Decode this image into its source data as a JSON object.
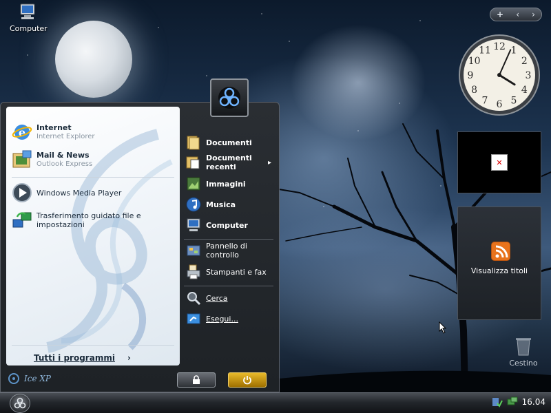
{
  "desktop": {
    "icons": [
      {
        "label": "Computer",
        "icon": "computer-icon"
      },
      {
        "label": "Cestino",
        "icon": "recycle-bin-icon"
      }
    ]
  },
  "start_menu": {
    "pinned": [
      {
        "title": "Internet",
        "subtitle": "Internet Explorer",
        "icon": "internet-explorer-icon"
      },
      {
        "title": "Mail & News",
        "subtitle": "Outlook Express",
        "icon": "outlook-express-icon"
      }
    ],
    "recent": [
      {
        "label": "Windows Media Player",
        "icon": "media-player-icon"
      },
      {
        "label": "Trasferimento guidato file e impostazioni",
        "icon": "file-transfer-icon"
      }
    ],
    "all_programs": "Tutti i programmi",
    "places": [
      {
        "label": "Documenti",
        "icon": "documents-icon"
      },
      {
        "label": "Documenti recenti",
        "icon": "recent-documents-icon"
      },
      {
        "label": "Immagini",
        "icon": "pictures-icon"
      },
      {
        "label": "Musica",
        "icon": "music-icon"
      },
      {
        "label": "Computer",
        "icon": "computer-icon"
      }
    ],
    "settings": [
      {
        "label": "Pannello di controllo",
        "icon": "control-panel-icon"
      },
      {
        "label": "Stampanti e fax",
        "icon": "printer-icon"
      }
    ],
    "tools": [
      {
        "label": "Cerca",
        "icon": "search-icon"
      },
      {
        "label": "Esegui...",
        "icon": "run-icon"
      }
    ],
    "brand": "Ice XP",
    "lock_icon": "lock-icon",
    "power_icon": "power-icon"
  },
  "sidebar": {
    "toolbar": {
      "add": "+",
      "prev": "‹",
      "next": "›"
    },
    "feed_label": "Visualizza titoli"
  },
  "clock": {
    "hours": [
      12,
      1,
      2,
      3,
      4,
      5,
      6,
      7,
      8,
      9,
      10,
      11
    ],
    "time": "16:04"
  },
  "taskbar": {
    "time": "16.04"
  },
  "colors": {
    "accent": "#d9a400",
    "feed_orange": "#e8731c",
    "menu_dark": "#24282d"
  }
}
